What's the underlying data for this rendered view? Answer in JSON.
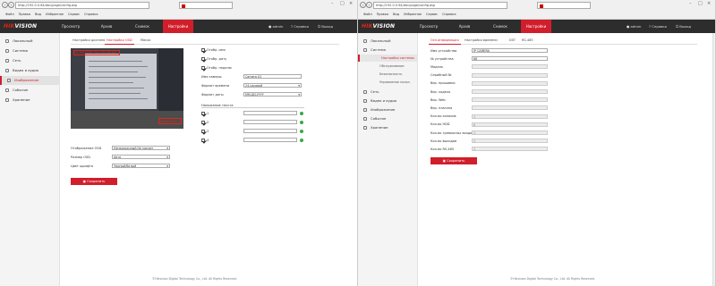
{
  "left": {
    "url": "http://192.0.0.64/doc/page/config.asp",
    "tab_title": "",
    "menu": [
      "Файл",
      "Правка",
      "Вид",
      "Избранное",
      "Сервис",
      "Справка"
    ],
    "logo_red": "HIK",
    "logo_white": "VISION",
    "nav": [
      "Просмотр",
      "Архив",
      "Снимок",
      "Настройки"
    ],
    "nav_active": 3,
    "user": "admin",
    "help": "Справка",
    "logout": "Выход",
    "sidebar": [
      "Локальный",
      "Система",
      "Сеть",
      "Видео и аудио",
      "Изображение",
      "Событие",
      "Хранение"
    ],
    "sidebar_active": 4,
    "subtabs": [
      "Настройки дисплея",
      "Настройки OSD",
      "Маска"
    ],
    "subtab_active": 1,
    "osd_texts": {
      "top": "11-24-2016 Thu 12:26:16",
      "name_red": "Camera 01"
    },
    "checkboxes": [
      {
        "label": "Отобр. имя",
        "on": true
      },
      {
        "label": "Отобр. дату",
        "on": true
      },
      {
        "label": "Отобр. неделю",
        "on": true
      }
    ],
    "camera_name_label": "Имя камеры",
    "camera_name": "Camera 01",
    "time_format_label": "Формат времени",
    "time_format": "24-часовой",
    "date_format_label": "Формат даты",
    "date_format": "MM-DD-YYYY",
    "text_overlay_title": "Наложение текста",
    "overlays": [
      "1",
      "2",
      "3",
      "4"
    ],
    "overlay_values": [
      "",
      "",
      "",
      ""
    ],
    "osd_mode_label": "Отображение OSD",
    "osd_mode": "Непрозрачный,Не мигает",
    "osd_size_label": "Размер OSD",
    "osd_size": "Авто",
    "font_color_label": "Цвет шрифта",
    "font_color": "Черный/белый",
    "save": "Сохранить",
    "footer": "©Hikvision Digital Technology Co., Ltd. All Rights Reserved."
  },
  "right": {
    "url": "http://192.0.0.64/doc/page/config.asp",
    "tab_title": "",
    "menu": [
      "Файл",
      "Правка",
      "Вид",
      "Избранное",
      "Сервис",
      "Справка"
    ],
    "logo_red": "HIK",
    "logo_white": "VISION",
    "nav": [
      "Просмотр",
      "Архив",
      "Снимок",
      "Настройки"
    ],
    "nav_active": 3,
    "user": "admin",
    "help": "Справка",
    "logout": "Выход",
    "sidebar": [
      "Локальный",
      "Система",
      "Настройки системы",
      "Обслуживание",
      "Безопасность",
      "Управление польз.",
      "Сеть",
      "Видео и аудио",
      "Изображение",
      "Событие",
      "Хранение"
    ],
    "sidebar_active": 2,
    "sidebar_sub": [
      2,
      3,
      4,
      5
    ],
    "subtabs": [
      "Осн.информация",
      "Настройки времени",
      "DST",
      "RS-485"
    ],
    "subtab_active": 0,
    "fields": [
      {
        "label": "Имя устройства",
        "value": "IP CAMERA",
        "editable": true
      },
      {
        "label": "№ устройства",
        "value": "88",
        "editable": true
      },
      {
        "label": "Модель",
        "value": "",
        "editable": false
      },
      {
        "label": "Серийный №",
        "value": "",
        "editable": false
      },
      {
        "label": "Вер. прошивки",
        "value": "",
        "editable": false
      },
      {
        "label": "Вер. кодека",
        "value": "",
        "editable": false
      },
      {
        "label": "Вер. Web",
        "value": "",
        "editable": false
      },
      {
        "label": "Вер. плагина",
        "value": "",
        "editable": false
      },
      {
        "label": "Кол-во каналов",
        "value": "1",
        "editable": false
      },
      {
        "label": "Кол-во HDD",
        "value": "0",
        "editable": false
      },
      {
        "label": "Кол-во тревожных входов",
        "value": "1",
        "editable": false
      },
      {
        "label": "Кол-во выходов",
        "value": "1",
        "editable": false
      },
      {
        "label": "Кол-во RS-485",
        "value": "1",
        "editable": false
      }
    ],
    "save": "Сохранить",
    "footer": "©Hikvision Digital Technology Co., Ltd. All Rights Reserved."
  },
  "colors": {
    "accent": "#d11e2b",
    "topbar": "#2d2d2d",
    "ok": "#3aa845"
  }
}
